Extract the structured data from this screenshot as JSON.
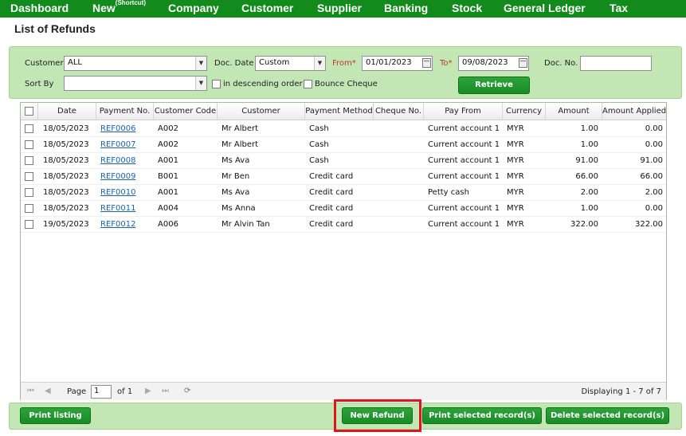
{
  "nav": {
    "items": [
      "Dashboard",
      "New",
      "Company",
      "Customer",
      "Supplier",
      "Banking",
      "Stock",
      "General Ledger",
      "Tax"
    ],
    "new_sup": "(Shortcut)"
  },
  "page": {
    "title": "List of Refunds"
  },
  "filters": {
    "customer_label": "Customer",
    "customer_value": "ALL",
    "doc_date_label": "Doc. Date",
    "doc_date_value": "Custom",
    "from_label": "From*",
    "from_value": "01/01/2023",
    "to_label": "To*",
    "to_value": "09/08/2023",
    "doc_no_label": "Doc. No.",
    "doc_no_value": "",
    "sort_by_label": "Sort By",
    "sort_by_value": "",
    "descending_label": "in descending order",
    "bounce_label": "Bounce Cheque",
    "retrieve_label": "Retrieve"
  },
  "table": {
    "columns": [
      "Date",
      "Payment No.",
      "Customer Code",
      "Customer",
      "Payment Method",
      "Cheque No.",
      "Pay From",
      "Currency",
      "Amount",
      "Amount Applied"
    ],
    "rows": [
      [
        "18/05/2023",
        "REF0006",
        "A002",
        "Mr Albert",
        "Cash",
        "",
        "Current account 1",
        "MYR",
        "1.00",
        "0.00"
      ],
      [
        "18/05/2023",
        "REF0007",
        "A002",
        "Mr Albert",
        "Cash",
        "",
        "Current account 1",
        "MYR",
        "1.00",
        "0.00"
      ],
      [
        "18/05/2023",
        "REF0008",
        "A001",
        "Ms Ava",
        "Cash",
        "",
        "Current account 1",
        "MYR",
        "91.00",
        "91.00"
      ],
      [
        "18/05/2023",
        "REF0009",
        "B001",
        "Mr Ben",
        "Credit card",
        "",
        "Current account 1",
        "MYR",
        "66.00",
        "66.00"
      ],
      [
        "18/05/2023",
        "REF0010",
        "A001",
        "Ms Ava",
        "Credit card",
        "",
        "Petty cash",
        "MYR",
        "2.00",
        "2.00"
      ],
      [
        "18/05/2023",
        "REF0011",
        "A004",
        "Ms Anna",
        "Credit card",
        "",
        "Current account 1",
        "MYR",
        "1.00",
        "0.00"
      ],
      [
        "19/05/2023",
        "REF0012",
        "A006",
        "Mr Alvin Tan",
        "Credit card",
        "",
        "Current account 1",
        "MYR",
        "322.00",
        "322.00"
      ]
    ]
  },
  "pager": {
    "page_label": "Page",
    "page_value": "1",
    "of_label": "of 1",
    "displaying": "Displaying 1 - 7 of 7"
  },
  "actions": {
    "print_listing": "Print listing",
    "new_refund": "New Refund",
    "print_selected": "Print selected record(s)",
    "delete_selected": "Delete selected record(s)"
  }
}
